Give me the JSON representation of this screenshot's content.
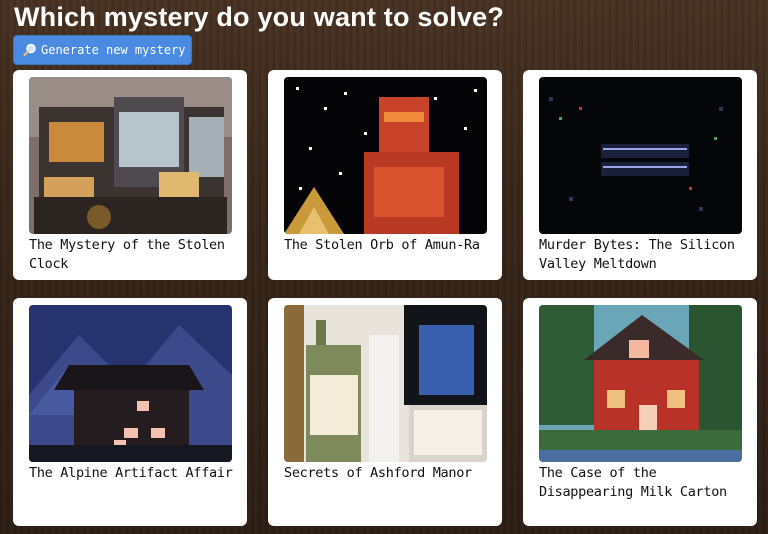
{
  "header": {
    "title": "Which mystery do you want to solve?",
    "generate_button_label": "Generate new mystery",
    "generate_button_icon": "magnifier-icon"
  },
  "mysteries": [
    {
      "title": "The Mystery of the Stolen Clock",
      "image": "steampunk-building-image"
    },
    {
      "title": "The Stolen Orb of Amun-Ra",
      "image": "pixel-sphinx-image"
    },
    {
      "title": "Murder Bytes: The Silicon Valley Meltdown",
      "image": "pixel-screen-text-image"
    },
    {
      "title": "The Alpine Artifact Affair",
      "image": "pixel-mountain-chalet-image"
    },
    {
      "title": "Secrets of Ashford Manor",
      "image": "old-bottles-image"
    },
    {
      "title": "The Case of the Disappearing Milk Carton",
      "image": "pixel-red-house-image"
    }
  ],
  "colors": {
    "button": "#4a8ae0",
    "card": "#ffffff",
    "background": "#3a281b"
  }
}
